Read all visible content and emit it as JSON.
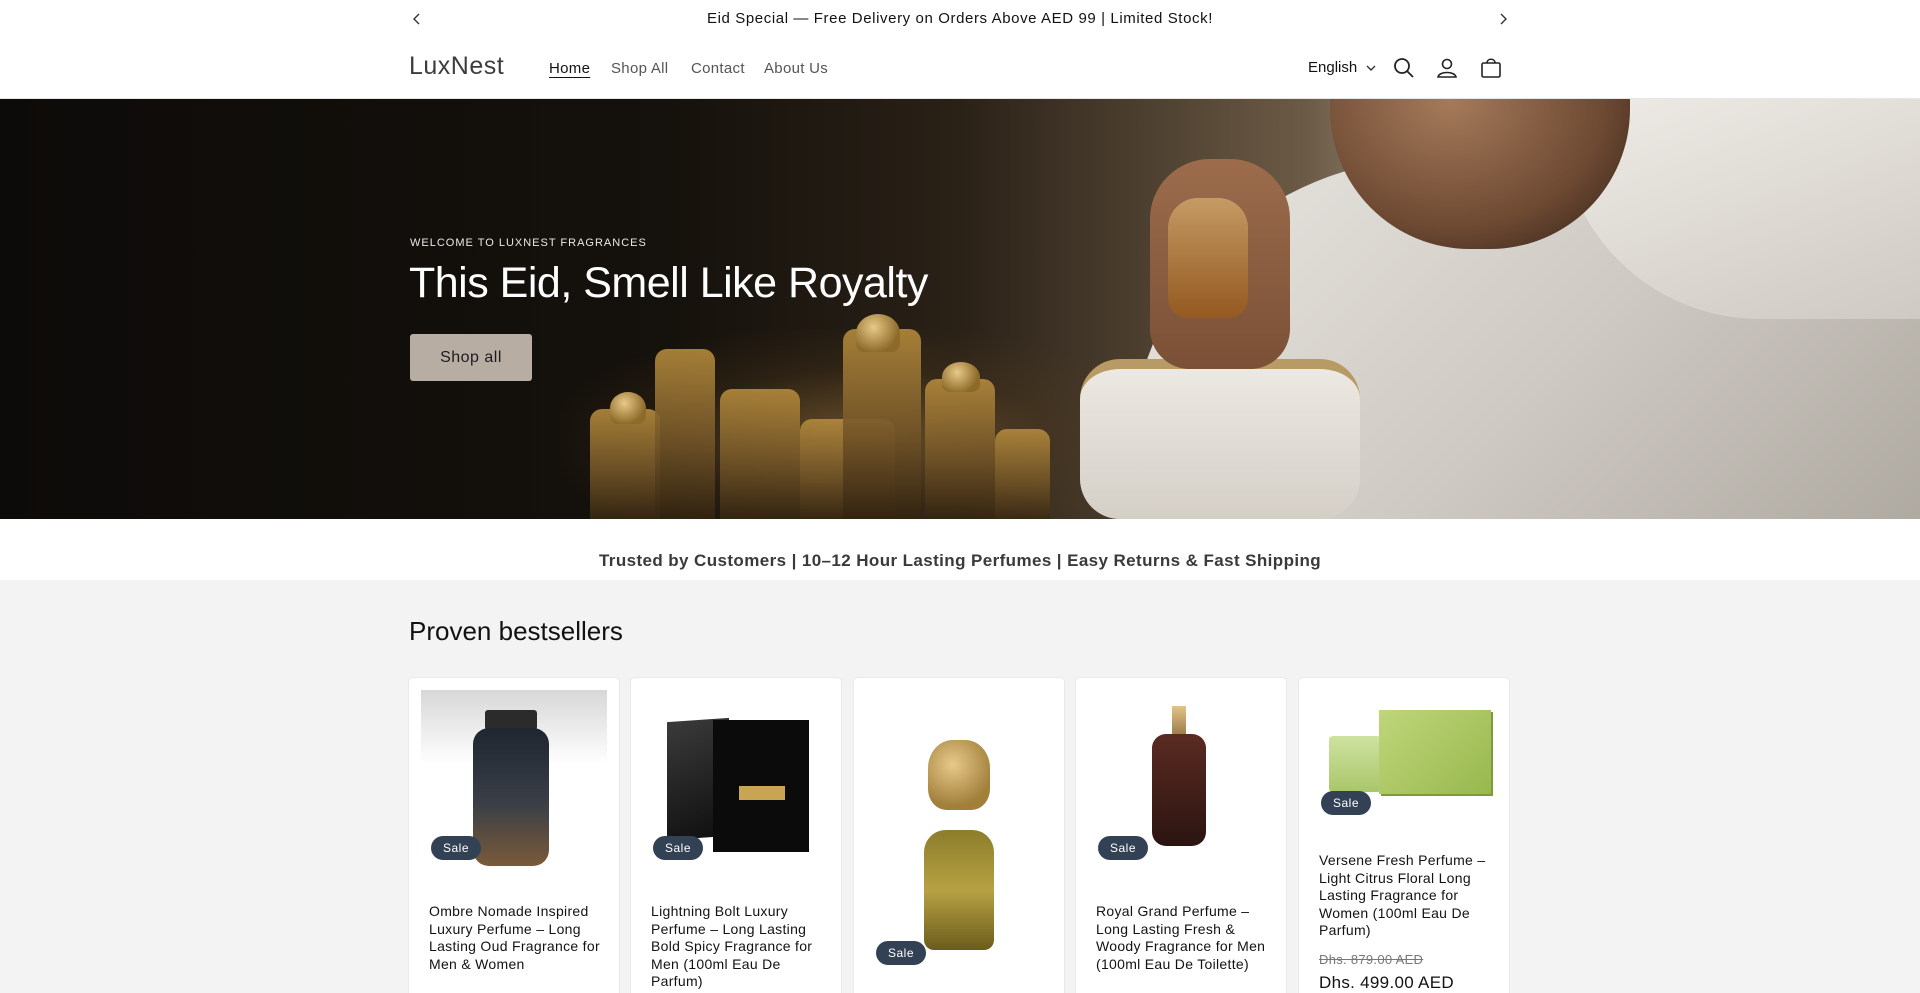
{
  "announcement": {
    "text": "Eid Special — Free Delivery on Orders Above AED 99 | Limited Stock!",
    "prev_icon": "chevron-left-icon",
    "next_icon": "chevron-right-icon"
  },
  "header": {
    "logo": "LuxNest",
    "nav": [
      {
        "label": "Home",
        "active": true
      },
      {
        "label": "Shop All",
        "active": false
      },
      {
        "label": "Contact",
        "active": false
      },
      {
        "label": "About Us",
        "active": false
      }
    ],
    "language": "English",
    "icons": [
      "search-icon",
      "account-icon",
      "cart-icon"
    ]
  },
  "hero": {
    "subtitle": "WELCOME TO LUXNEST FRAGRANCES",
    "title": "This Eid, Smell Like Royalty",
    "button": "Shop all"
  },
  "trust_bar": {
    "text": "Trusted by Customers | 10–12 Hour Lasting Perfumes | Easy Returns & Fast Shipping"
  },
  "bestsellers": {
    "title": "Proven bestsellers",
    "products": [
      {
        "name": "Ombre Nomade Inspired Luxury Perfume – Long Lasting Oud Fragrance for Men & Women",
        "badge": "Sale"
      },
      {
        "name": "Lightning Bolt Luxury Perfume – Long Lasting Bold Spicy Fragrance for Men (100ml Eau De Parfum)",
        "badge": "Sale"
      },
      {
        "name": "",
        "badge": "Sale"
      },
      {
        "name": "Royal Grand Perfume – Long Lasting Fresh & Woody Fragrance for Men (100ml Eau De Toilette)",
        "badge": "Sale"
      },
      {
        "name": "Versene Fresh Perfume – Light Citrus Floral Long Lasting Fragrance for Women (100ml Eau De Parfum)",
        "badge": "Sale",
        "price_old": "Dhs. 879.00 AED",
        "price_new": "Dhs. 499.00 AED"
      }
    ]
  },
  "colors": {
    "sale_badge": "#334155",
    "hero_button": "#b7ada3",
    "page_bg": "#f3f3f3"
  }
}
